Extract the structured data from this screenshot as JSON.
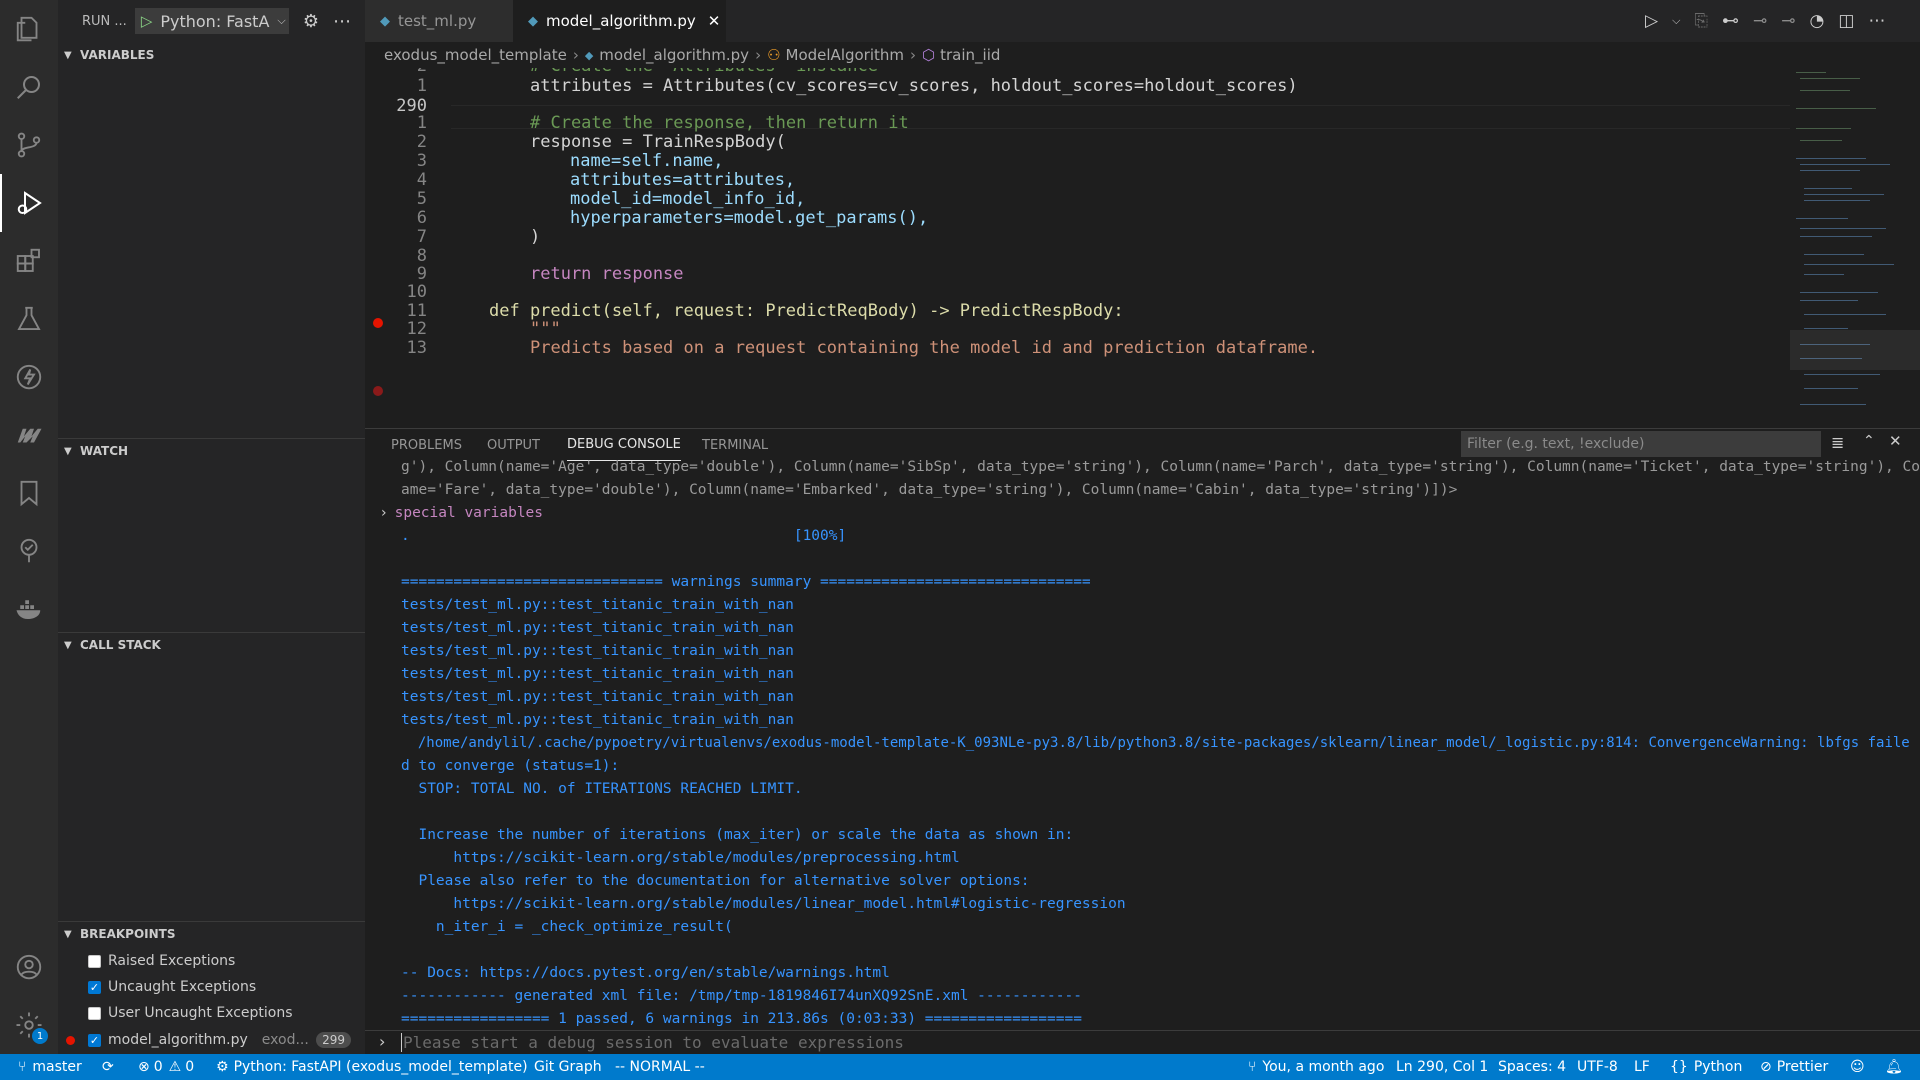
{
  "colors": {
    "accent": "#007acc",
    "statusbar": "#007acc",
    "breakpoint": "#e51400",
    "console_text": "#3794ff"
  },
  "run_panel": {
    "title": "RUN ...",
    "config": "Python: FastA"
  },
  "activity_bar": [
    "explorer-icon",
    "search-icon",
    "source-control-icon",
    "run-debug-icon",
    "extensions-icon",
    "testing-icon",
    "thunder-icon",
    "vim-icon",
    "bookmark-icon",
    "git-graph-icon",
    "docker-icon",
    "account-icon",
    "settings-icon"
  ],
  "sections": {
    "variables": "VARIABLES",
    "watch": "WATCH",
    "call_stack": "CALL STACK",
    "breakpoints": "BREAKPOINTS"
  },
  "breakpoints": [
    {
      "label": "Raised Exceptions",
      "checked": false
    },
    {
      "label": "Uncaught Exceptions",
      "checked": true
    },
    {
      "label": "User Uncaught Exceptions",
      "checked": false
    }
  ],
  "breakpoint_file": {
    "label": "model_algorithm.py",
    "path": "exod...",
    "line": "299"
  },
  "settings_badge": "1",
  "tabs": [
    {
      "label": "test_ml.py"
    },
    {
      "label": "model_algorithm.py"
    }
  ],
  "breadcrumb": [
    "exodus_model_template",
    "model_algorithm.py",
    "ModelAlgorithm",
    "train_iid"
  ],
  "editor": {
    "line_numbers": [
      "2",
      "1",
      "290",
      "1",
      "2",
      "3",
      "4",
      "5",
      "6",
      "7",
      "8",
      "9",
      "10",
      "11",
      "12",
      "13"
    ],
    "lines": [
      "# Create the `Attributes` instance",
      "attributes = Attributes(cv_scores=cv_scores, holdout_scores=holdout_scores)",
      "",
      "# Create the response, then return it",
      "response = TrainRespBody(",
      "name=self.name,",
      "attributes=attributes,",
      "model_id=model_info_id,",
      "hyperparameters=model.get_params(),",
      ")",
      "",
      "return response",
      "",
      "def predict(self, request: PredictReqBody) -> PredictRespBody:",
      "\"\"\"",
      "Predicts based on a request containing the model id and prediction dataframe."
    ]
  },
  "panel": {
    "tabs": [
      "PROBLEMS",
      "OUTPUT",
      "DEBUG CONSOLE",
      "TERMINAL"
    ],
    "filter_placeholder": "Filter (e.g. text, !exclude)",
    "lines": [
      "g'), Column(name='Age', data_type='double'), Column(name='SibSp', data_type='string'), Column(name='Parch', data_type='string'), Column(name='Ticket', data_type='string'), Column(n",
      "ame='Fare', data_type='double'), Column(name='Embarked', data_type='string'), Column(name='Cabin', data_type='string')])>",
      "special variables",
      ".                                            [100%]",
      "",
      "============================== warnings summary ===============================",
      "tests/test_ml.py::test_titanic_train_with_nan",
      "tests/test_ml.py::test_titanic_train_with_nan",
      "tests/test_ml.py::test_titanic_train_with_nan",
      "tests/test_ml.py::test_titanic_train_with_nan",
      "tests/test_ml.py::test_titanic_train_with_nan",
      "tests/test_ml.py::test_titanic_train_with_nan",
      "  /home/andylil/.cache/pypoetry/virtualenvs/exodus-model-template-K_093NLe-py3.8/lib/python3.8/site-packages/sklearn/linear_model/_logistic.py:814: ConvergenceWarning: lbfgs faile",
      "d to converge (status=1):",
      "  STOP: TOTAL NO. of ITERATIONS REACHED LIMIT.",
      "",
      "  Increase the number of iterations (max_iter) or scale the data as shown in:",
      "      https://scikit-learn.org/stable/modules/preprocessing.html",
      "  Please also refer to the documentation for alternative solver options:",
      "      https://scikit-learn.org/stable/modules/linear_model.html#logistic-regression",
      "    n_iter_i = _check_optimize_result(",
      "",
      "-- Docs: https://docs.pytest.org/en/stable/warnings.html",
      "------------ generated xml file: /tmp/tmp-1819846I74unXQ92SnE.xml ------------",
      "================= 1 passed, 6 warnings in 213.86s (0:03:33) =================="
    ],
    "input_placeholder": "Please start a debug session to evaluate expressions"
  },
  "status": {
    "branch": "master",
    "errors": "0",
    "warnings": "0",
    "interpreter": "Python: FastAPI (exodus_model_template)",
    "git_graph": "Git Graph",
    "vim_mode": "-- NORMAL --",
    "blame": "You, a month ago",
    "position": "Ln 290, Col 1",
    "spaces": "Spaces: 4",
    "encoding": "UTF-8",
    "eol": "LF",
    "language": "Python",
    "formatter": "Prettier"
  }
}
